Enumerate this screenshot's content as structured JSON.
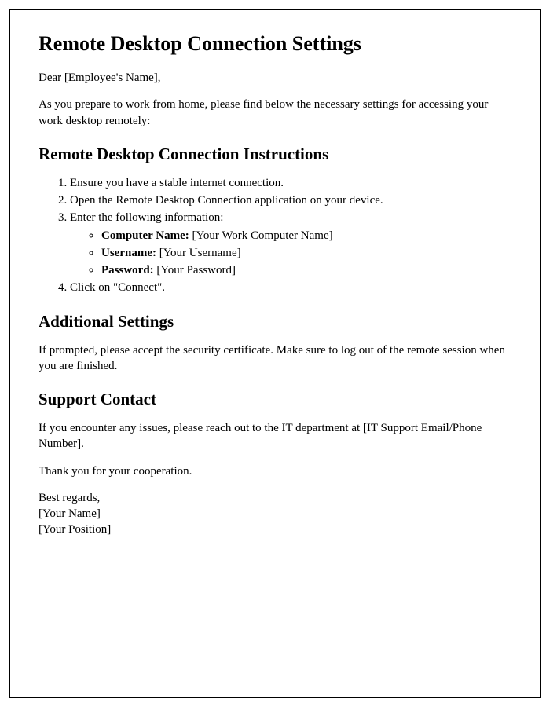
{
  "title": "Remote Desktop Connection Settings",
  "salutation": "Dear [Employee's Name],",
  "intro": "As you prepare to work from home, please find below the necessary settings for accessing your work desktop remotely:",
  "instructions": {
    "heading": "Remote Desktop Connection Instructions",
    "step1": "Ensure you have a stable internet connection.",
    "step2": "Open the Remote Desktop Connection application on your device.",
    "step3": "Enter the following information:",
    "fields": {
      "computer_label": "Computer Name:",
      "computer_value": " [Your Work Computer Name]",
      "username_label": "Username:",
      "username_value": " [Your Username]",
      "password_label": "Password:",
      "password_value": " [Your Password]"
    },
    "step4": "Click on \"Connect\"."
  },
  "additional": {
    "heading": "Additional Settings",
    "text": "If prompted, please accept the security certificate. Make sure to log out of the remote session when you are finished."
  },
  "support": {
    "heading": "Support Contact",
    "text": "If you encounter any issues, please reach out to the IT department at [IT Support Email/Phone Number]."
  },
  "closing": {
    "thanks": "Thank you for your cooperation.",
    "regards": "Best regards,",
    "name": "[Your Name]",
    "position": "[Your Position]"
  }
}
